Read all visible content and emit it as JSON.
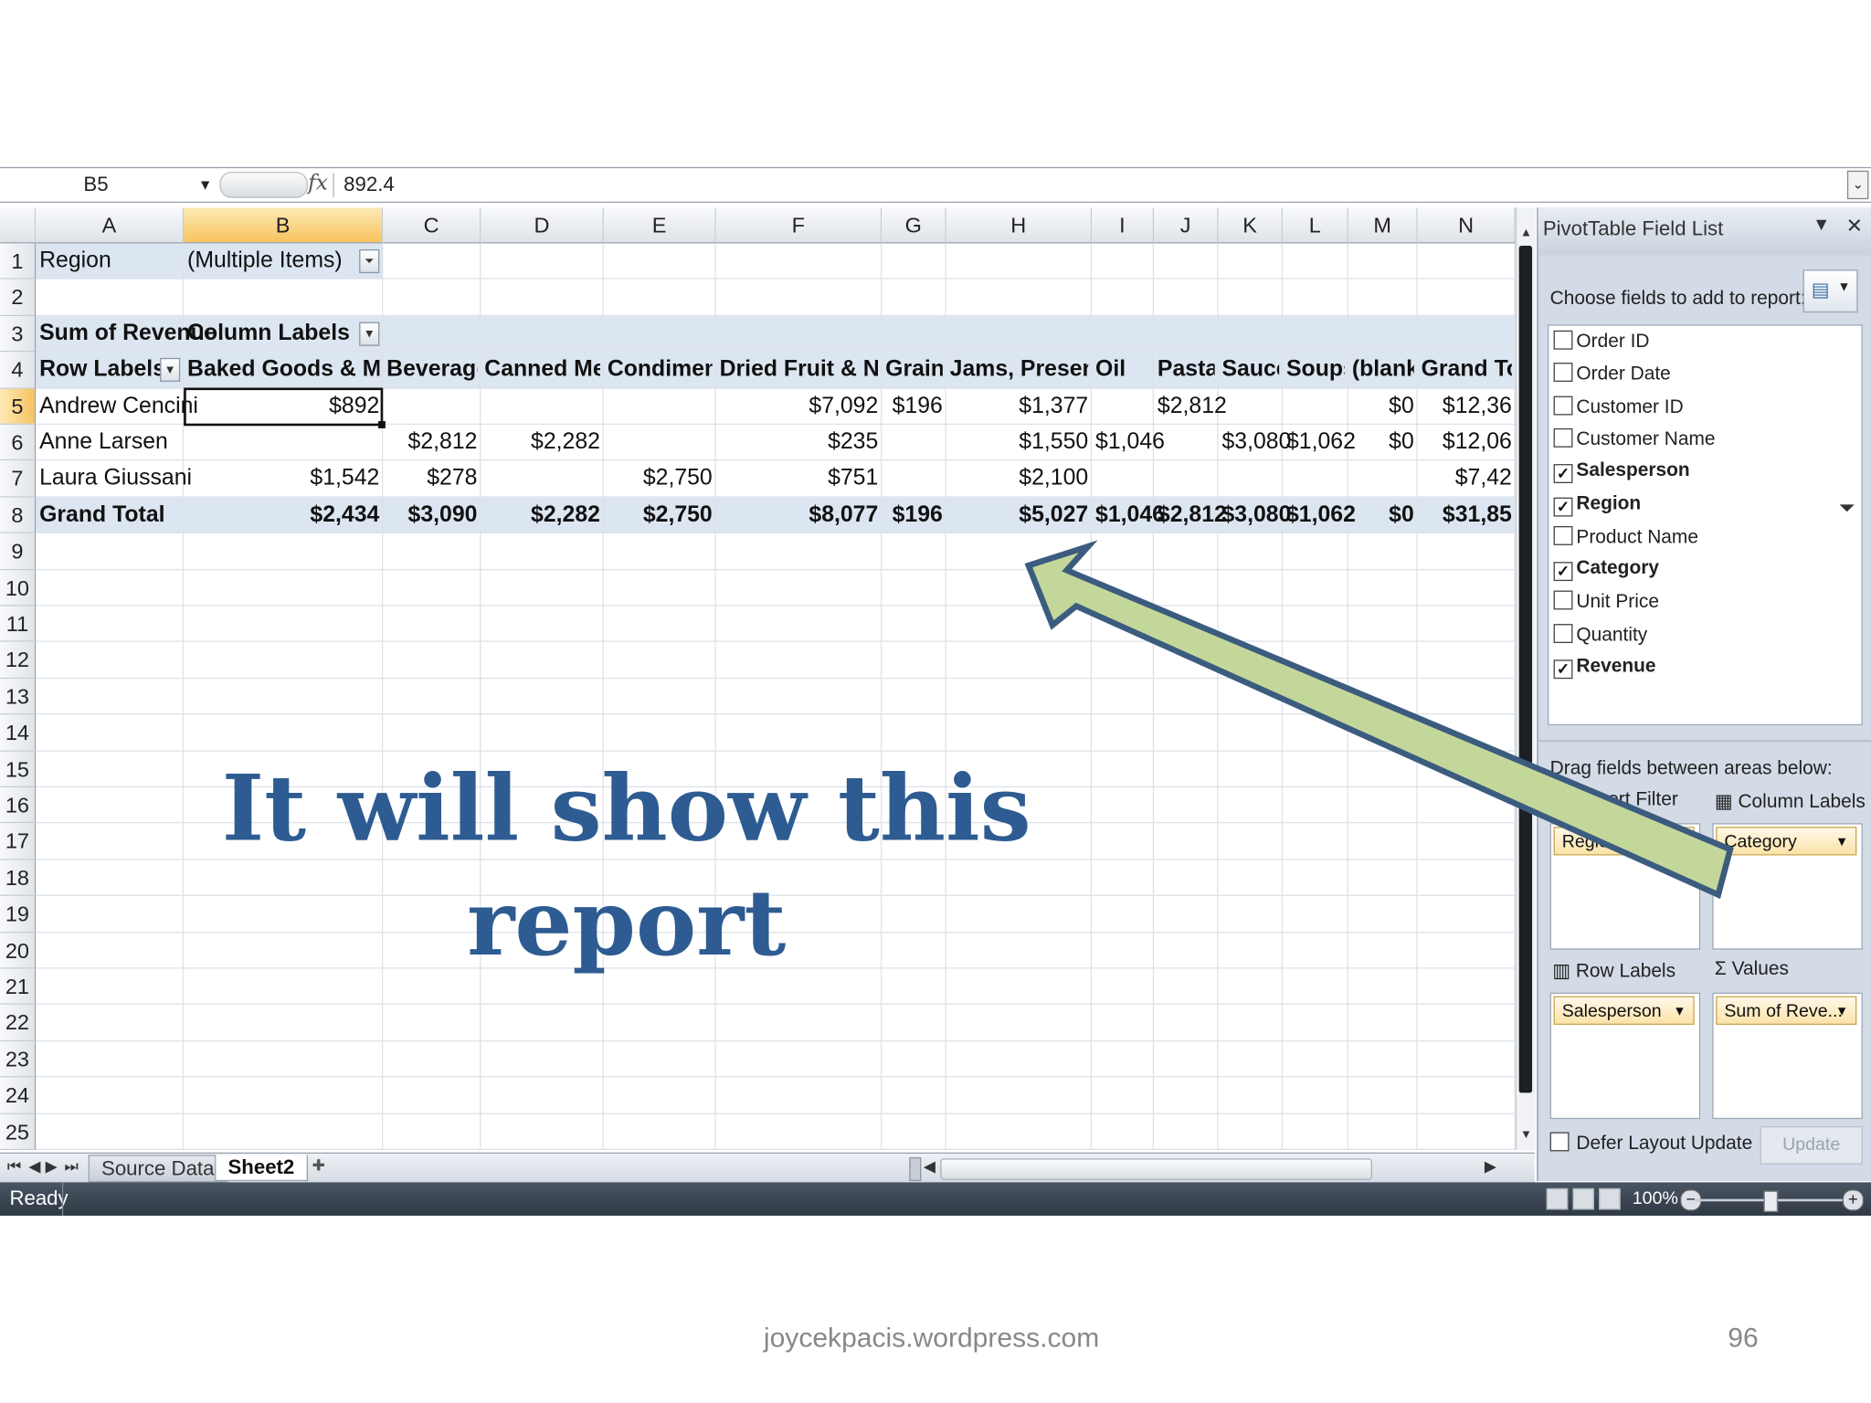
{
  "formula_bar": {
    "name_box": "B5",
    "fx": "fx",
    "value": "892.4",
    "expand": "⌄"
  },
  "columns": [
    {
      "label": "",
      "w": 30
    },
    {
      "label": "A",
      "w": 124
    },
    {
      "label": "B",
      "w": 167
    },
    {
      "label": "C",
      "w": 82
    },
    {
      "label": "D",
      "w": 103
    },
    {
      "label": "E",
      "w": 94
    },
    {
      "label": "F",
      "w": 139
    },
    {
      "label": "G",
      "w": 54
    },
    {
      "label": "H",
      "w": 122
    },
    {
      "label": "I",
      "w": 52
    },
    {
      "label": "J",
      "w": 54
    },
    {
      "label": "K",
      "w": 54
    },
    {
      "label": "L",
      "w": 55
    },
    {
      "label": "M",
      "w": 58
    },
    {
      "label": "N",
      "w": 82
    }
  ],
  "row_numbers": [
    "1",
    "2",
    "3",
    "4",
    "5",
    "6",
    "7",
    "8",
    "9",
    "10",
    "11",
    "12",
    "13",
    "14",
    "15",
    "16",
    "17",
    "18",
    "19",
    "20",
    "21",
    "22",
    "23",
    "24",
    "25"
  ],
  "pivot_table": {
    "filter_label": "Region",
    "filter_value": "(Multiple Items)",
    "values_label": "Sum of Revenue",
    "column_labels": "Column Labels",
    "row_labels": "Row Labels",
    "categories": [
      "Baked Goods & Mixes",
      "Beverages",
      "Canned Meat",
      "Condiments",
      "Dried Fruit & Nuts",
      "Grains",
      "Jams, Preserves",
      "Oil",
      "Pasta",
      "Sauces",
      "Soups",
      "(blank)",
      "Grand Tota"
    ],
    "rows": [
      {
        "name": "Andrew Cencini",
        "values": [
          "$892",
          "",
          "",
          "",
          "$7,092",
          "$196",
          "$1,377",
          "",
          "$2,812",
          "",
          "",
          "$0",
          "$12,36"
        ]
      },
      {
        "name": "Anne Larsen",
        "values": [
          "",
          "$2,812",
          "$2,282",
          "",
          "$235",
          "",
          "$1,550",
          "$1,046",
          "",
          "$3,080",
          "$1,062",
          "$0",
          "$12,06"
        ]
      },
      {
        "name": "Laura Giussani",
        "values": [
          "$1,542",
          "$278",
          "",
          "$2,750",
          "$751",
          "",
          "$2,100",
          "",
          "",
          "",
          "",
          "",
          "$7,42"
        ]
      }
    ],
    "total": {
      "name": "Grand Total",
      "values": [
        "$2,434",
        "$3,090",
        "$2,282",
        "$2,750",
        "$8,077",
        "$196",
        "$5,027",
        "$1,046",
        "$2,812",
        "$3,080",
        "$1,062",
        "$0",
        "$31,85"
      ]
    }
  },
  "sheet_tabs": {
    "source": "Source Data",
    "sheet2": "Sheet2"
  },
  "status": {
    "text": "Ready",
    "zoom": "100%",
    "minus": "−",
    "plus": "+"
  },
  "field_list": {
    "title": "PivotTable Field List",
    "choose": "Choose fields to add to report:",
    "fields": [
      {
        "name": "Order ID",
        "checked": false
      },
      {
        "name": "Order Date",
        "checked": false
      },
      {
        "name": "Customer ID",
        "checked": false
      },
      {
        "name": "Customer Name",
        "checked": false
      },
      {
        "name": "Salesperson",
        "checked": true
      },
      {
        "name": "Region",
        "checked": true
      },
      {
        "name": "Product Name",
        "checked": false
      },
      {
        "name": "Category",
        "checked": true
      },
      {
        "name": "Unit Price",
        "checked": false
      },
      {
        "name": "Quantity",
        "checked": false
      },
      {
        "name": "Revenue",
        "checked": true
      }
    ],
    "drag_text": "Drag fields between areas below:",
    "report_filter_label": "Report Filter",
    "column_labels_label": "Column Labels",
    "row_labels_label": "Row Labels",
    "values_label": "Values",
    "report_filter_chip": "Region",
    "column_labels_chip": "Category",
    "row_labels_chip": "Salesperson",
    "values_chip": "Sum of Reve...",
    "defer": "Defer Layout Update",
    "update": "Update"
  },
  "callout": {
    "line1": "It will show this",
    "line2": "report"
  },
  "footer": {
    "site": "joycekpacis.wordpress.com",
    "page": "96"
  },
  "colors": {
    "accent_text": "#2e5c92",
    "arrow_fill": "#c4d79b",
    "arrow_stroke": "#3b5c7e",
    "pivot_band": "#dce6f1"
  }
}
